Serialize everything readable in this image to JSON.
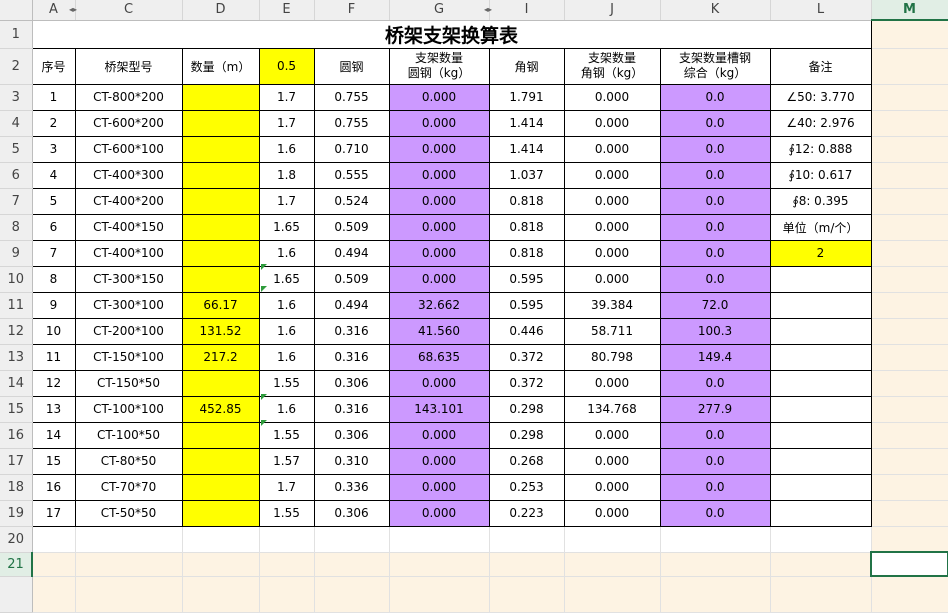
{
  "columns": [
    "A",
    "C",
    "D",
    "E",
    "F",
    "G",
    "I",
    "J",
    "K",
    "L",
    "M"
  ],
  "row_numbers": [
    1,
    2,
    3,
    4,
    5,
    6,
    7,
    8,
    9,
    10,
    11,
    12,
    13,
    14,
    15,
    16,
    17,
    18,
    19,
    20,
    21
  ],
  "selected_column": "M",
  "selected_row": 21,
  "title": "桥架支架换算表",
  "headers": {
    "seq": "序号",
    "model": "桥架型号",
    "qty": "数量（m）",
    "factor": "0.5",
    "round_steel": "圆钢",
    "round_qty_line1": "支架数量",
    "round_qty_line2": "圆钢（kg）",
    "angle_steel": "角钢",
    "angle_qty_line1": "支架数量",
    "angle_qty_line2": "角钢（kg）",
    "channel_line1": "支架数量槽钢",
    "channel_line2": "综合（kg）",
    "remark": "备注"
  },
  "rows": [
    {
      "seq": "1",
      "model": "CT-800*200",
      "qty": "",
      "e": "1.7",
      "f": "0.755",
      "g": "0.000",
      "i": "1.791",
      "j": "0.000",
      "k": "0.0",
      "note": "∠50: 3.770"
    },
    {
      "seq": "2",
      "model": "CT-600*200",
      "qty": "",
      "e": "1.7",
      "f": "0.755",
      "g": "0.000",
      "i": "1.414",
      "j": "0.000",
      "k": "0.0",
      "note": "∠40: 2.976"
    },
    {
      "seq": "3",
      "model": "CT-600*100",
      "qty": "",
      "e": "1.6",
      "f": "0.710",
      "g": "0.000",
      "i": "1.414",
      "j": "0.000",
      "k": "0.0",
      "note": "∮12: 0.888"
    },
    {
      "seq": "4",
      "model": "CT-400*300",
      "qty": "",
      "e": "1.8",
      "f": "0.555",
      "g": "0.000",
      "i": "1.037",
      "j": "0.000",
      "k": "0.0",
      "note": "∮10: 0.617"
    },
    {
      "seq": "5",
      "model": "CT-400*200",
      "qty": "",
      "e": "1.7",
      "f": "0.524",
      "g": "0.000",
      "i": "0.818",
      "j": "0.000",
      "k": "0.0",
      "note": "∮8: 0.395"
    },
    {
      "seq": "6",
      "model": "CT-400*150",
      "qty": "",
      "e": "1.65",
      "f": "0.509",
      "g": "0.000",
      "i": "0.818",
      "j": "0.000",
      "k": "0.0",
      "note": "单位（m/个）"
    },
    {
      "seq": "7",
      "model": "CT-400*100",
      "qty": "",
      "e": "1.6",
      "f": "0.494",
      "g": "0.000",
      "i": "0.818",
      "j": "0.000",
      "k": "0.0",
      "note": "2"
    },
    {
      "seq": "8",
      "model": "CT-300*150",
      "qty": "",
      "e": "1.65",
      "f": "0.509",
      "g": "0.000",
      "i": "0.595",
      "j": "0.000",
      "k": "0.0",
      "note": ""
    },
    {
      "seq": "9",
      "model": "CT-300*100",
      "qty": "66.17",
      "e": "1.6",
      "f": "0.494",
      "g": "32.662",
      "i": "0.595",
      "j": "39.384",
      "k": "72.0",
      "note": ""
    },
    {
      "seq": "10",
      "model": "CT-200*100",
      "qty": "131.52",
      "e": "1.6",
      "f": "0.316",
      "g": "41.560",
      "i": "0.446",
      "j": "58.711",
      "k": "100.3",
      "note": ""
    },
    {
      "seq": "11",
      "model": "CT-150*100",
      "qty": "217.2",
      "e": "1.6",
      "f": "0.316",
      "g": "68.635",
      "i": "0.372",
      "j": "80.798",
      "k": "149.4",
      "note": ""
    },
    {
      "seq": "12",
      "model": "CT-150*50",
      "qty": "",
      "e": "1.55",
      "f": "0.306",
      "g": "0.000",
      "i": "0.372",
      "j": "0.000",
      "k": "0.0",
      "note": ""
    },
    {
      "seq": "13",
      "model": "CT-100*100",
      "qty": "452.85",
      "e": "1.6",
      "f": "0.316",
      "g": "143.101",
      "i": "0.298",
      "j": "134.768",
      "k": "277.9",
      "note": ""
    },
    {
      "seq": "14",
      "model": "CT-100*50",
      "qty": "",
      "e": "1.55",
      "f": "0.306",
      "g": "0.000",
      "i": "0.298",
      "j": "0.000",
      "k": "0.0",
      "note": ""
    },
    {
      "seq": "15",
      "model": "CT-80*50",
      "qty": "",
      "e": "1.57",
      "f": "0.310",
      "g": "0.000",
      "i": "0.268",
      "j": "0.000",
      "k": "0.0",
      "note": ""
    },
    {
      "seq": "16",
      "model": "CT-70*70",
      "qty": "",
      "e": "1.7",
      "f": "0.336",
      "g": "0.000",
      "i": "0.253",
      "j": "0.000",
      "k": "0.0",
      "note": ""
    },
    {
      "seq": "17",
      "model": "CT-50*50",
      "qty": "",
      "e": "1.55",
      "f": "0.306",
      "g": "0.000",
      "i": "0.223",
      "j": "0.000",
      "k": "0.0",
      "note": ""
    }
  ],
  "colors": {
    "yellow_fill": "#ffff00",
    "purple_fill": "#cc99ff",
    "selection": "#217346",
    "header_bg": "#efefef",
    "tint": "#fdf3e3"
  },
  "icons": {
    "hidden_column_marker": "hidden-columns-icon",
    "comment_marker": "comment-indicator-icon"
  }
}
